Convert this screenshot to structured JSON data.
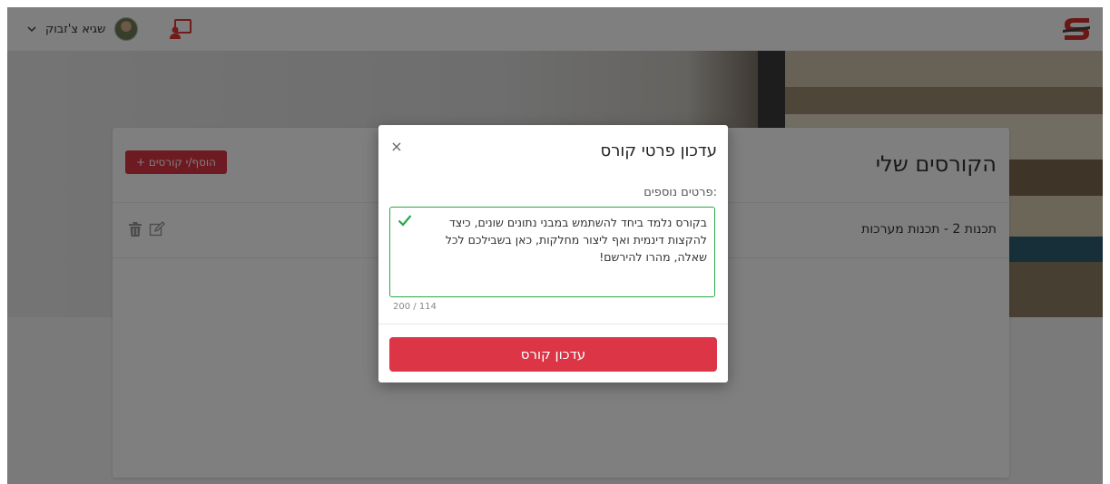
{
  "header": {
    "user_name": "שגיא צ'זבוק"
  },
  "courses_card": {
    "title": "הקורסים שלי",
    "add_button_label": "+ הוסף/י קורסים",
    "courses": [
      {
        "name": "תכנות 2 - תכנות מערכות"
      }
    ]
  },
  "modal": {
    "title": "עדכון פרטי קורס",
    "close_symbol": "×",
    "field_label": "פרטים נוספים:",
    "field_value": "בקורס נלמד ביחד להשתמש במבני נתונים שונים, כיצד להקצות דינמית ואף ליצור מחלקות, כאן בשבילכם לכל שאלה, מהרו להירשם!",
    "char_counter": "200 / 114",
    "submit_label": "עדכון קורס"
  },
  "colors": {
    "accent": "#dc3545",
    "valid": "#28a745",
    "overlay": "rgba(0,0,0,0.5)"
  }
}
